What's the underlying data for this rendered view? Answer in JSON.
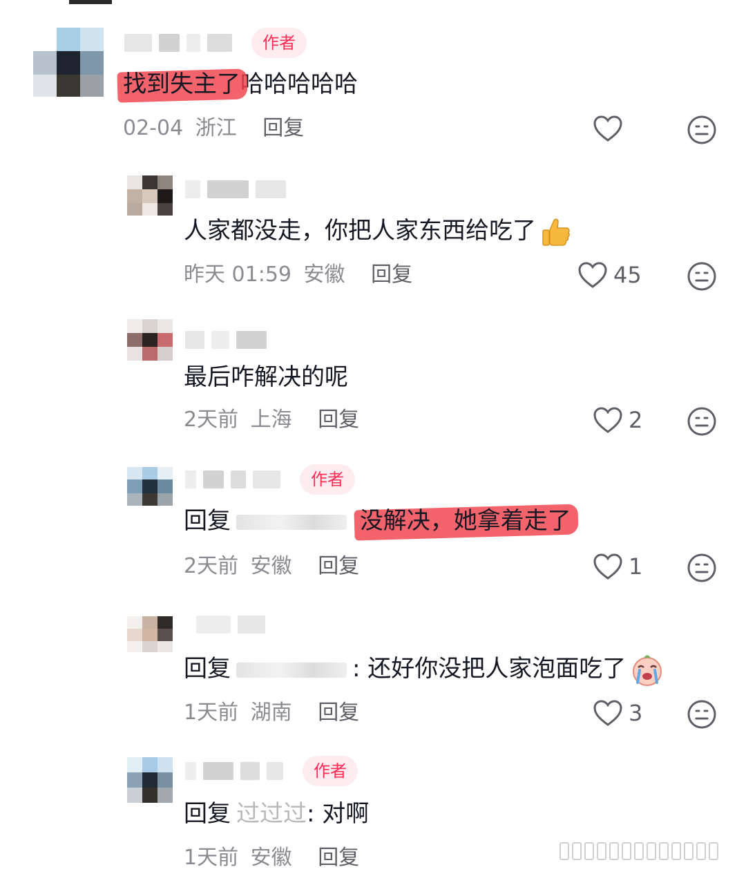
{
  "comments": [
    {
      "badge": "作者",
      "text_highlight": "找到失主了",
      "text_rest": "哈哈哈哈哈",
      "time": "02-04",
      "location": "浙江",
      "reply_label": "回复",
      "likes": ""
    },
    {
      "text": "人家都没走，你把人家东西给吃了",
      "emoji": "thumbs-up-emoji",
      "time": "昨天 01:59",
      "location": "安徽",
      "reply_label": "回复",
      "likes": "45"
    },
    {
      "text": "最后咋解决的呢",
      "time": "2天前",
      "location": "上海",
      "reply_label": "回复",
      "likes": "2"
    },
    {
      "badge": "作者",
      "text_prefix": "回复",
      "text_highlight": "没解决，她拿着走了",
      "time": "2天前",
      "location": "安徽",
      "reply_label": "回复",
      "likes": "1"
    },
    {
      "text_prefix": "回复",
      "text": ": 还好你没把人家泡面吃了",
      "emoji": "crying-emoji",
      "time": "1天前",
      "location": "湖南",
      "reply_label": "回复",
      "likes": "3"
    },
    {
      "badge": "作者",
      "text_prefix": "回复",
      "mention": "过过过",
      "text": ": 对啊",
      "time": "1天前",
      "location": "安徽",
      "reply_label": "回复",
      "likes": ""
    }
  ],
  "icons": {
    "like": "heart-outline-icon",
    "dislike": "neutral-face-icon"
  },
  "colors": {
    "author_badge_bg": "#fdecef",
    "author_badge_text": "#fe2c55",
    "highlight": "#f0414b",
    "meta_text": "#8a8b91"
  }
}
